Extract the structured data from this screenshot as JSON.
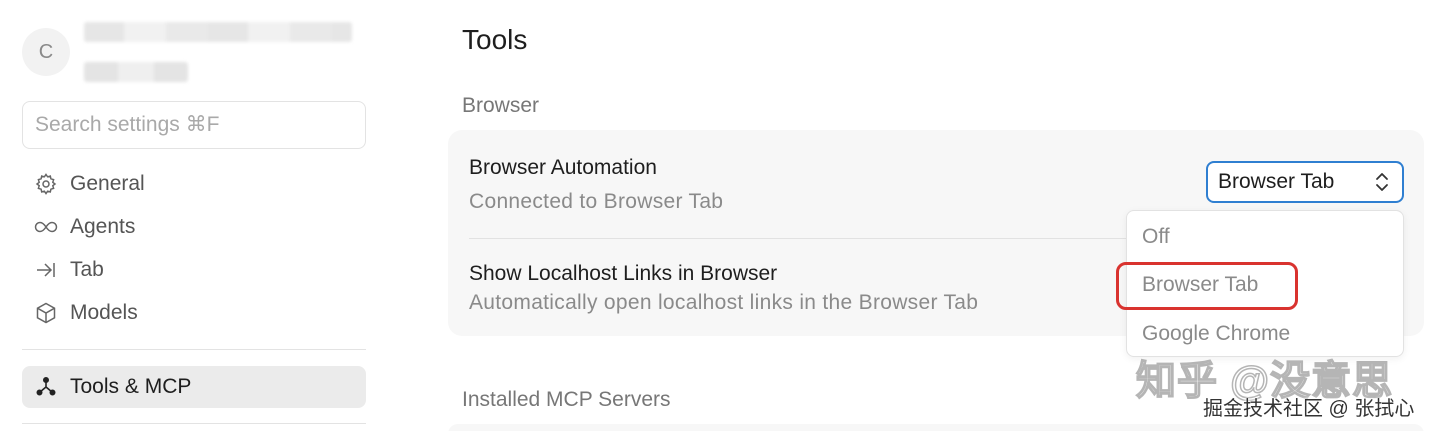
{
  "sidebar": {
    "avatar_initial": "C",
    "search_placeholder": "Search settings ⌘F",
    "items": [
      {
        "label": "General",
        "icon": "gear-icon"
      },
      {
        "label": "Agents",
        "icon": "infinity-icon"
      },
      {
        "label": "Tab",
        "icon": "arrow-to-line-icon"
      },
      {
        "label": "Models",
        "icon": "cube-icon"
      }
    ],
    "active_item": {
      "label": "Tools & MCP",
      "icon": "nodes-icon"
    }
  },
  "main": {
    "title": "Tools",
    "browser_section": "Browser",
    "browser_automation": {
      "title": "Browser Automation",
      "description": "Connected to Browser Tab",
      "selected": "Browser Tab",
      "options": [
        "Off",
        "Browser Tab",
        "Google Chrome"
      ]
    },
    "localhost_links": {
      "title": "Show Localhost Links in Browser",
      "description": "Automatically open localhost links in the Browser Tab"
    },
    "mcp_section": "Installed MCP Servers"
  },
  "watermark": {
    "line1": "知乎 @没意思",
    "line2": "掘金技术社区 @ 张拭心"
  },
  "colors": {
    "accent_blue": "#2f7fd1",
    "highlight_red": "#d9332f",
    "active_bg": "#ebebeb",
    "card_bg": "#f7f7f7"
  }
}
